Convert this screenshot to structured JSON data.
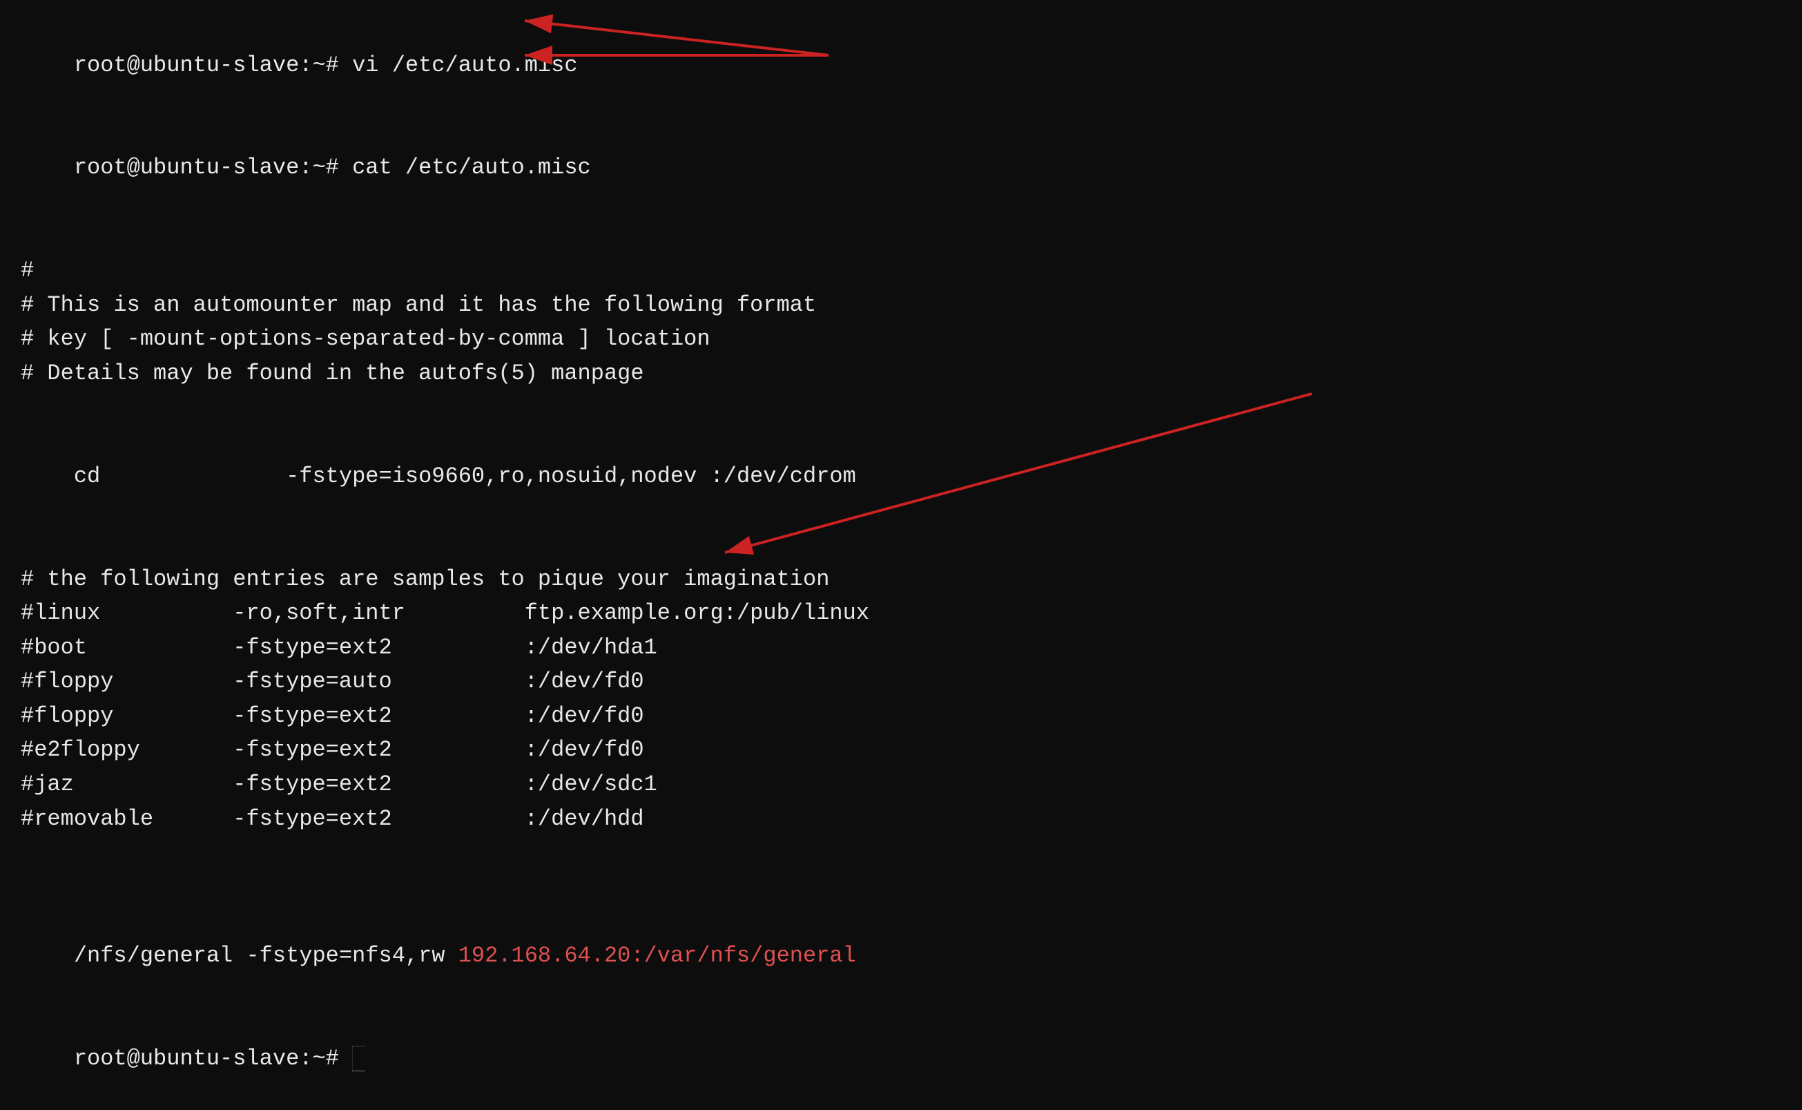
{
  "terminal": {
    "lines": [
      {
        "type": "prompt",
        "text": "root@ubuntu-slave:~# vi /etc/auto.misc"
      },
      {
        "type": "prompt",
        "text": "root@ubuntu-slave:~# cat /etc/auto.misc"
      },
      {
        "type": "blank"
      },
      {
        "type": "comment",
        "text": "#"
      },
      {
        "type": "comment",
        "text": "# This is an automounter map and it has the following format"
      },
      {
        "type": "comment",
        "text": "# key [ -mount-options-separated-by-comma ] location"
      },
      {
        "type": "comment",
        "text": "# Details may be found in the autofs(5) manpage"
      },
      {
        "type": "blank"
      },
      {
        "type": "normal",
        "text": "cd              -fstype=iso9660,ro,nosuid,nodev :/dev/cdrom"
      },
      {
        "type": "blank"
      },
      {
        "type": "comment",
        "text": "# the following entries are samples to pique your imagination"
      },
      {
        "type": "comment",
        "text": "#linux          -ro,soft,intr         ftp.example.org:/pub/linux"
      },
      {
        "type": "comment",
        "text": "#boot           -fstype=ext2          :/dev/hda1"
      },
      {
        "type": "comment",
        "text": "#floppy         -fstype=auto          :/dev/fd0"
      },
      {
        "type": "comment",
        "text": "#floppy         -fstype=ext2          :/dev/fd0"
      },
      {
        "type": "comment",
        "text": "#e2floppy       -fstype=ext2          :/dev/fd0"
      },
      {
        "type": "comment",
        "text": "#jaz            -fstype=ext2          :/dev/sdc1"
      },
      {
        "type": "comment",
        "text": "#removable      -fstype=ext2          :/dev/hdd"
      },
      {
        "type": "blank"
      },
      {
        "type": "blank"
      },
      {
        "type": "nfs",
        "prefix": "/nfs/general -fstype=nfs4,rw ",
        "highlight": "192.168.64.20:/var/nfs/general",
        "suffix": ""
      },
      {
        "type": "prompt_cursor",
        "text": "root@ubuntu-slave:~# "
      }
    ]
  }
}
